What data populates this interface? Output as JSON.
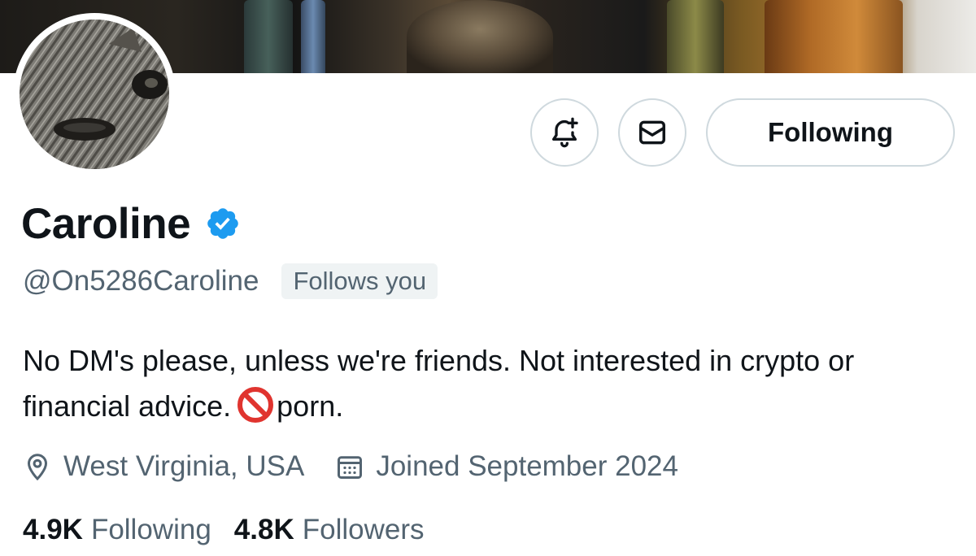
{
  "profile": {
    "display_name": "Caroline",
    "handle": "@On5286Caroline",
    "follows_you_label": "Follows you",
    "bio_part1": "No DM's please, unless we're friends. Not interested in crypto or financial advice.",
    "bio_emoji": "prohibited-icon",
    "bio_part2": "porn.",
    "location": "West Virginia, USA",
    "joined": "Joined September 2024",
    "following_count": "4.9K",
    "following_label": "Following",
    "followers_count": "4.8K",
    "followers_label": "Followers"
  },
  "actions": {
    "notify_icon": "bell-plus-icon",
    "message_icon": "envelope-icon",
    "follow_button_label": "Following"
  },
  "colors": {
    "verified_blue": "#1d9bf0",
    "secondary_text": "#536471",
    "prohibited_red": "#e0342f"
  }
}
